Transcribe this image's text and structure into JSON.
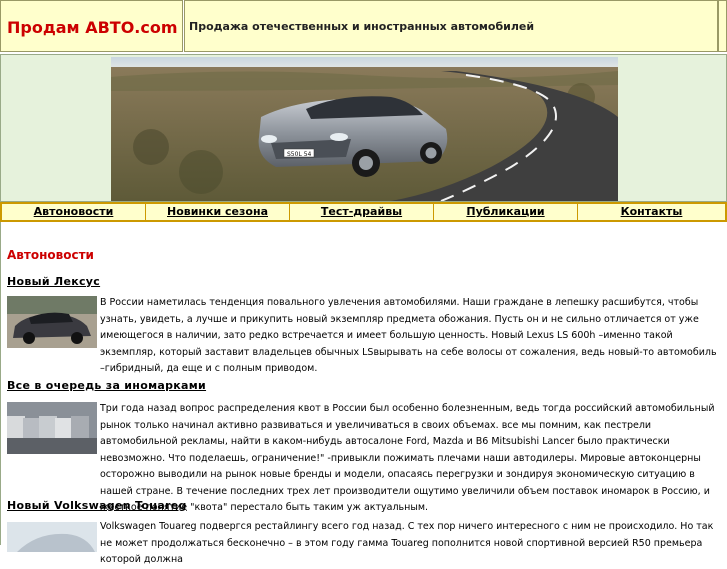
{
  "site": {
    "logo": "Продам АВТО.com",
    "tagline": "Продажа отечественных и иностранных автомобилей"
  },
  "banner": {
    "plate_text": "S50L 54"
  },
  "nav": {
    "items": [
      {
        "label": "Автоновости"
      },
      {
        "label": "Новинки сезона"
      },
      {
        "label": "Тест-драйвы"
      },
      {
        "label": "Публикации"
      },
      {
        "label": "Контакты"
      }
    ]
  },
  "main": {
    "section_title": "Автоновости",
    "articles": [
      {
        "title": "Новый Лексус",
        "text": "В России наметилась тенденция повального увлечения автомобилями. Наши граждане в лепешку расшибутся, чтобы узнать, увидеть, а лучше и прикупить новый экземпляр предмета обожания. Пусть он и не сильно отличается от уже имеющегося в наличии, зато редко встречается и имеет большую ценность. Новый Lexus LS 600h –именно такой экземпляр, который заставит владельцев обычных LSвырывать на себе волосы от сожаления, ведь новый-то автомобиль –гибридный, да еще и с полным приводом."
      },
      {
        "title": "Все в очередь за иномарками",
        "text": "Три года назад вопрос распределения квот в России был особенно болезненным, ведь тогда российский автомобильный рынок только начинал активно развиваться и увеличиваться в своих объемах. все мы помним, как пестрели автомобильной рекламы, найти в каком-нибудь автосалоне Ford, Mazda и B6 Mitsubishi Lancer было практически невозможно. Что поделаешь, ограничение!\" -привыкли пожимать плечами наши автодилеры. Мировые автоконцерны осторожно выводили на рынок новые бренды и модели, опасаясь перегрузки и зондируя экономическую ситуацию в нашей стране. В течение последних трех лет производители ощутимо увеличили объем поставок иномарок в Россию, и жесткое понятие \"квота\" перестало быть таким уж актуальным."
      },
      {
        "title": "Новый Volkswagen Touareg",
        "text": "Volkswagen Touareg подвергся рестайлингу всего год назад. С тех пор ничего интересного с ним не происходило. Но так не может продолжаться бесконечно – в этом году гамма Touareg пополнится новой спортивной версией R50 премьера которой должна"
      }
    ]
  }
}
